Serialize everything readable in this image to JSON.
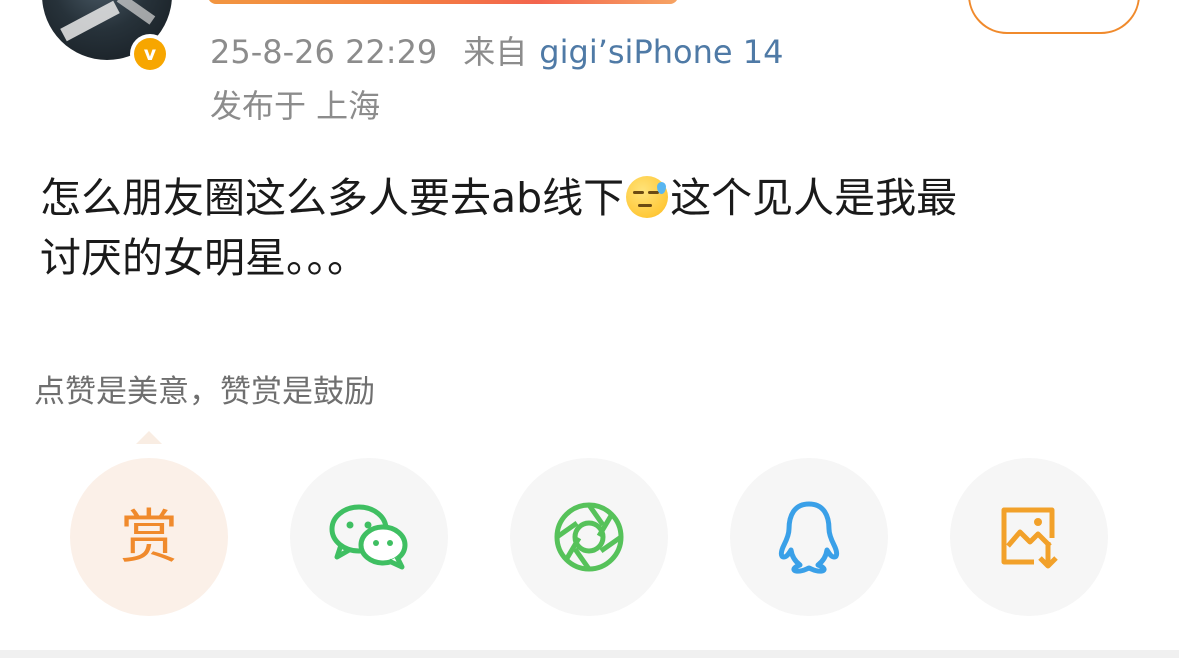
{
  "post": {
    "timestamp": "25-8-26 22:29",
    "source_prefix": "来自",
    "device": "gigi’siPhone 14",
    "location": "发布于 上海",
    "text_line1_a": "怎么朋友圈这么多人要去ab线下",
    "text_line1_b": "这个见人是我最",
    "text_line2": "讨厌的女明星。。。",
    "emoji": "sweat-smile-emoji"
  },
  "verified_badge": "v",
  "reward": {
    "hint": "点赞是美意，赞赏是鼓励",
    "reward_label": "赏"
  },
  "share_buttons": [
    {
      "name": "reward",
      "icon": "reward-char",
      "color": "#f08a2c"
    },
    {
      "name": "wechat",
      "icon": "wechat-icon",
      "color": "#3fbf62"
    },
    {
      "name": "moments",
      "icon": "moments-icon",
      "color": "#56c25a"
    },
    {
      "name": "qq",
      "icon": "qq-icon",
      "color": "#3aa0e8"
    },
    {
      "name": "save-image",
      "icon": "save-image-icon",
      "color": "#f2a12a"
    }
  ],
  "colors": {
    "orange": "#f08a2c",
    "link_blue": "#4f7aa6",
    "meta_gray": "#8c8c8c"
  }
}
